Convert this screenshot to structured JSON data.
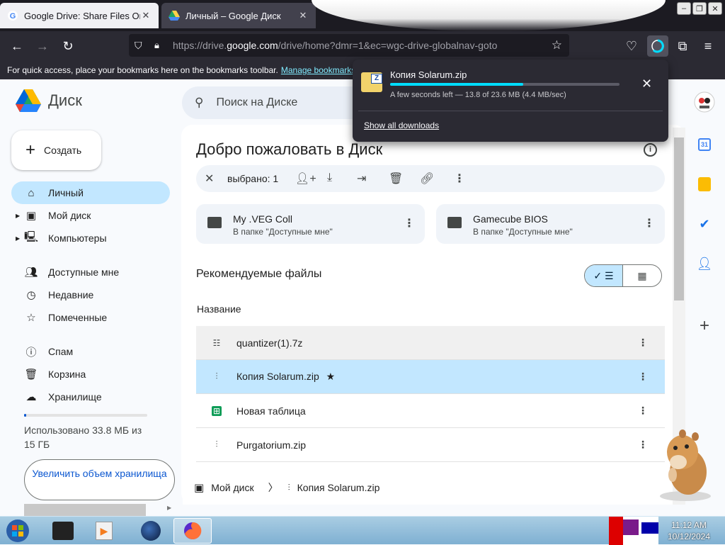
{
  "browser": {
    "tabs": [
      {
        "title": "Google Drive: Share Files Online",
        "close": "✕"
      },
      {
        "title": "Личный – Google Диск",
        "close": "✕"
      }
    ],
    "url_prefix": "https://drive.",
    "url_domain": "google.com",
    "url_rest": "/drive/home?dmr=1&ec=wgc-drive-globalnav-goto",
    "bookmarks_text": "For quick access, place your bookmarks here on the bookmarks toolbar.",
    "bookmarks_link": "Manage bookmarks..."
  },
  "download": {
    "file": "Копия Solarum.zip",
    "status": "A few seconds left — 13.8 of 23.6 MB (4.4 MB/sec)",
    "progress": 0.58,
    "show_all": "Show all downloads"
  },
  "drive": {
    "logo": "Диск",
    "search_placeholder": "Поиск на Диске",
    "create": "Создать",
    "nav": [
      {
        "label": "Личный",
        "icon": "home-icon"
      },
      {
        "label": "Мой диск",
        "icon": "my-drive-icon"
      },
      {
        "label": "Компьютеры",
        "icon": "computers-icon"
      },
      {
        "label": "Доступные мне",
        "icon": "shared-icon"
      },
      {
        "label": "Недавние",
        "icon": "recent-icon"
      },
      {
        "label": "Помеченные",
        "icon": "star-icon"
      },
      {
        "label": "Спам",
        "icon": "spam-icon"
      },
      {
        "label": "Корзина",
        "icon": "trash-icon"
      },
      {
        "label": "Хранилище",
        "icon": "cloud-icon"
      }
    ],
    "storage_used": "Использовано 33.8 МБ из 15 ГБ",
    "upgrade": "Увеличить объем хранилища",
    "welcome": "Добро пожаловать в Диск",
    "selected": "выбрано: 1",
    "folders": [
      {
        "name": "My .VEG Coll",
        "sub": "В папке \"Доступные мне\""
      },
      {
        "name": "Gamecube BIOS",
        "sub": "В папке \"Доступные мне\""
      }
    ],
    "recommended": "Рекомендуемые файлы",
    "column_name": "Название",
    "files": [
      {
        "name": "quantizer(1).7z"
      },
      {
        "name": "Копия Solarum.zip"
      },
      {
        "name": "Новая таблица"
      },
      {
        "name": "Purgatorium.zip"
      }
    ],
    "breadcrumb_root": "Мой диск",
    "breadcrumb_file": "Копия Solarum.zip"
  },
  "taskbar": {
    "time": "11:12 AM",
    "date": "10/12/2024"
  }
}
